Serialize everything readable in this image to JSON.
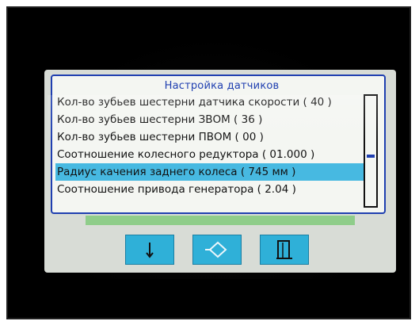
{
  "screen": {
    "title": "Настройка датчиков",
    "items": [
      {
        "label": "Кол-во зубьев шестерни датчика скорости ( 40 )",
        "selected": false
      },
      {
        "label": "Кол-во зубьев шестерни ЗВОМ ( 36 )",
        "selected": false
      },
      {
        "label": "Кол-во зубьев шестерни ПВОМ ( 00 )",
        "selected": false
      },
      {
        "label": "Соотношение колесного редуктора ( 01.000 )",
        "selected": false
      },
      {
        "label": "Радиус качения заднего колеса (  745 мм )",
        "selected": true
      },
      {
        "label": "Соотношение привода генератора ( 2.04 )",
        "selected": false
      }
    ],
    "scroll_position": 0.55
  },
  "buttons": {
    "down_icon": "arrow-down-icon",
    "enter_icon": "diamond-enter-icon",
    "exit_icon": "exit-door-icon"
  },
  "colors": {
    "accent_blue": "#1f3fb0",
    "selection": "#47b9e1",
    "button": "#2fb0d8",
    "panel": "#f4f6f2",
    "status_bar": "#8fcd8a"
  }
}
